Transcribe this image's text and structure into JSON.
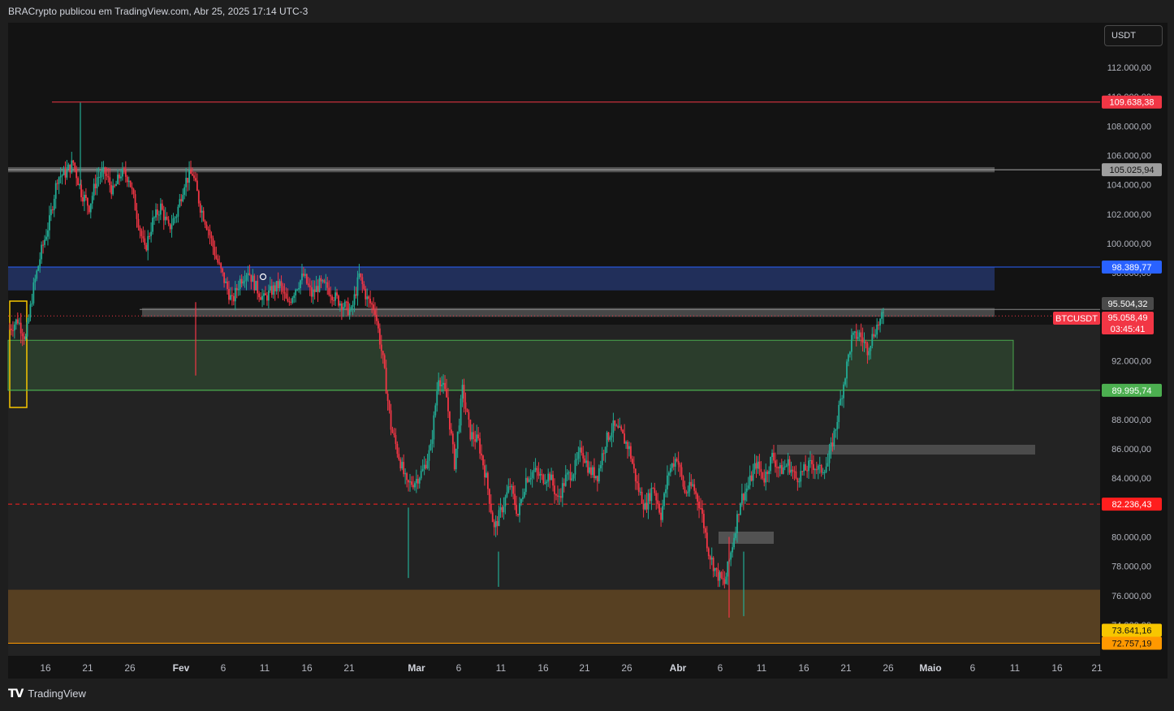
{
  "header": {
    "publish_text": "BRACrypto publicou em TradingView.com, Abr 25, 2025 17:14 UTC-3"
  },
  "footer": {
    "brand": "TradingView",
    "logo": "tradingview-logo-icon"
  },
  "currency": {
    "label": "USDT"
  },
  "colors": {
    "background": "#1e1e1e",
    "panel": "#131313",
    "up": "#22ab94",
    "down": "#f23645",
    "blue_zone": "#22305e",
    "green_zone": "#2b3d2c",
    "orange_zone": "#5a4120"
  },
  "chart_data": {
    "type": "candlestick",
    "symbol": "BTCUSDT",
    "ylim": [
      72000,
      114000
    ],
    "y_ticks": [
      {
        "v": 112000,
        "label": "112.000,00"
      },
      {
        "v": 110000,
        "label": "110.000,00"
      },
      {
        "v": 108000,
        "label": "108.000,00"
      },
      {
        "v": 106000,
        "label": "106.000,00"
      },
      {
        "v": 104000,
        "label": "104.000,00"
      },
      {
        "v": 102000,
        "label": "102.000,00"
      },
      {
        "v": 100000,
        "label": "100.000,00"
      },
      {
        "v": 98000,
        "label": "98.000,00"
      },
      {
        "v": 92000,
        "label": "92.000,00"
      },
      {
        "v": 88000,
        "label": "88.000,00"
      },
      {
        "v": 86000,
        "label": "86.000,00"
      },
      {
        "v": 84000,
        "label": "84.000,00"
      },
      {
        "v": 80000,
        "label": "80.000,00"
      },
      {
        "v": 78000,
        "label": "78.000,00"
      },
      {
        "v": 76000,
        "label": "76.000,00"
      },
      {
        "v": 74000,
        "label": "74.000,00"
      }
    ],
    "x_ticks": [
      {
        "label": "16",
        "bold": false
      },
      {
        "label": "21",
        "bold": false
      },
      {
        "label": "26",
        "bold": false
      },
      {
        "label": "Fev",
        "bold": true
      },
      {
        "label": "6",
        "bold": false
      },
      {
        "label": "11",
        "bold": false
      },
      {
        "label": "16",
        "bold": false
      },
      {
        "label": "21",
        "bold": false
      },
      {
        "label": "Mar",
        "bold": true
      },
      {
        "label": "6",
        "bold": false
      },
      {
        "label": "11",
        "bold": false
      },
      {
        "label": "16",
        "bold": false
      },
      {
        "label": "21",
        "bold": false
      },
      {
        "label": "26",
        "bold": false
      },
      {
        "label": "Abr",
        "bold": true
      },
      {
        "label": "6",
        "bold": false
      },
      {
        "label": "11",
        "bold": false
      },
      {
        "label": "16",
        "bold": false
      },
      {
        "label": "21",
        "bold": false
      },
      {
        "label": "26",
        "bold": false
      },
      {
        "label": "Maio",
        "bold": true
      },
      {
        "label": "6",
        "bold": false
      },
      {
        "label": "11",
        "bold": false
      },
      {
        "label": "16",
        "bold": false
      },
      {
        "label": "21",
        "bold": false
      }
    ],
    "price_path": [
      [
        0,
        94200
      ],
      [
        1,
        94800
      ],
      [
        2,
        93500
      ],
      [
        3,
        97000
      ],
      [
        4,
        99500
      ],
      [
        5,
        101500
      ],
      [
        6,
        104500
      ],
      [
        7,
        104800
      ],
      [
        8,
        105500
      ],
      [
        9,
        103500
      ],
      [
        10,
        102500
      ],
      [
        11,
        104500
      ],
      [
        12,
        104800
      ],
      [
        13,
        103500
      ],
      [
        14,
        104800
      ],
      [
        15,
        104500
      ],
      [
        16,
        102000
      ],
      [
        17,
        99500
      ],
      [
        18,
        101500
      ],
      [
        19,
        102500
      ],
      [
        20,
        101000
      ],
      [
        21,
        102000
      ],
      [
        22,
        104200
      ],
      [
        23,
        104800
      ],
      [
        24,
        102500
      ],
      [
        25,
        101000
      ],
      [
        26,
        99000
      ],
      [
        27,
        97500
      ],
      [
        28,
        96000
      ],
      [
        29,
        97500
      ],
      [
        30,
        98200
      ],
      [
        31,
        97000
      ],
      [
        32,
        96200
      ],
      [
        33,
        96800
      ],
      [
        34,
        97200
      ],
      [
        35,
        95800
      ],
      [
        36,
        97000
      ],
      [
        37,
        97800
      ],
      [
        38,
        96500
      ],
      [
        39,
        97200
      ],
      [
        40,
        97000
      ],
      [
        41,
        96300
      ],
      [
        42,
        95800
      ],
      [
        43,
        95300
      ],
      [
        44,
        97800
      ],
      [
        45,
        96200
      ],
      [
        46,
        95500
      ],
      [
        47,
        92000
      ],
      [
        48,
        87500
      ],
      [
        49,
        85500
      ],
      [
        50,
        83500
      ],
      [
        51,
        83800
      ],
      [
        52,
        84500
      ],
      [
        53,
        86000
      ],
      [
        54,
        91000
      ],
      [
        55,
        89500
      ],
      [
        56,
        85000
      ],
      [
        57,
        90000
      ],
      [
        58,
        87000
      ],
      [
        59,
        86500
      ],
      [
        60,
        84000
      ],
      [
        61,
        80500
      ],
      [
        62,
        82000
      ],
      [
        63,
        83500
      ],
      [
        64,
        81500
      ],
      [
        65,
        84000
      ],
      [
        66,
        84500
      ],
      [
        67,
        84000
      ],
      [
        68,
        84200
      ],
      [
        69,
        82500
      ],
      [
        70,
        84000
      ],
      [
        71,
        84500
      ],
      [
        72,
        86000
      ],
      [
        73,
        84500
      ],
      [
        74,
        84200
      ],
      [
        75,
        86500
      ],
      [
        76,
        87500
      ],
      [
        77,
        87000
      ],
      [
        78,
        86000
      ],
      [
        79,
        83500
      ],
      [
        80,
        82000
      ],
      [
        81,
        83500
      ],
      [
        82,
        81500
      ],
      [
        83,
        84500
      ],
      [
        84,
        85500
      ],
      [
        85,
        83000
      ],
      [
        86,
        83500
      ],
      [
        87,
        82000
      ],
      [
        88,
        79000
      ],
      [
        89,
        77500
      ],
      [
        90,
        76800
      ],
      [
        91,
        79500
      ],
      [
        92,
        82500
      ],
      [
        93,
        83500
      ],
      [
        94,
        85000
      ],
      [
        95,
        84000
      ],
      [
        96,
        85500
      ],
      [
        97,
        84500
      ],
      [
        98,
        85000
      ],
      [
        99,
        84000
      ],
      [
        100,
        84500
      ],
      [
        101,
        85000
      ],
      [
        102,
        84500
      ],
      [
        103,
        85000
      ],
      [
        104,
        87500
      ],
      [
        105,
        90500
      ],
      [
        106,
        93500
      ],
      [
        107,
        93800
      ],
      [
        108,
        92800
      ],
      [
        109,
        94200
      ],
      [
        110,
        95058
      ]
    ],
    "levels": [
      {
        "name": "resistance-109638",
        "value": 109638.38,
        "label": "109.638,38",
        "color": "#f23645",
        "style": "solid"
      },
      {
        "name": "level-105025",
        "value": 105025.94,
        "label": "105.025,94",
        "color": "#aaaaaa",
        "style": "solid"
      },
      {
        "name": "level-98389",
        "value": 98389.77,
        "label": "98.389,77",
        "color": "#2962ff",
        "style": "solid"
      },
      {
        "name": "level-95504",
        "value": 95504.32,
        "label": "95.504,32",
        "color": "#888888",
        "style": "solid"
      },
      {
        "name": "level-89995",
        "value": 89995.74,
        "label": "89.995,74",
        "color": "#4caf50",
        "style": "solid"
      },
      {
        "name": "level-82236",
        "value": 82236.43,
        "label": "82.236,43",
        "color": "#ff2020",
        "style": "dashed"
      },
      {
        "name": "level-73641",
        "value": 73641.16,
        "label": "73.641,16",
        "color": "#f7c600",
        "style": "none"
      },
      {
        "name": "level-72757",
        "value": 72757.19,
        "label": "72.757,19",
        "color": "#ff9800",
        "style": "solid"
      }
    ],
    "zones": [
      {
        "name": "gray-zone-top",
        "from": 104850,
        "to": 105200,
        "color": "#555555"
      },
      {
        "name": "blue-zone",
        "from": 96800,
        "to": 98400,
        "color": "#22305e"
      },
      {
        "name": "gray-zone-mid",
        "from": 95000,
        "to": 95600,
        "color": "#4a4a4a"
      },
      {
        "name": "green-zone",
        "from": 90000,
        "to": 93400,
        "color": "#2c3f2d"
      },
      {
        "name": "orange-zone",
        "from": 72750,
        "to": 76400,
        "color": "#5b4223"
      }
    ],
    "current": {
      "symbol": "BTCUSDT",
      "price": "95.058,49",
      "countdown": "03:45:41",
      "value": 95058.49
    },
    "grid": false
  }
}
